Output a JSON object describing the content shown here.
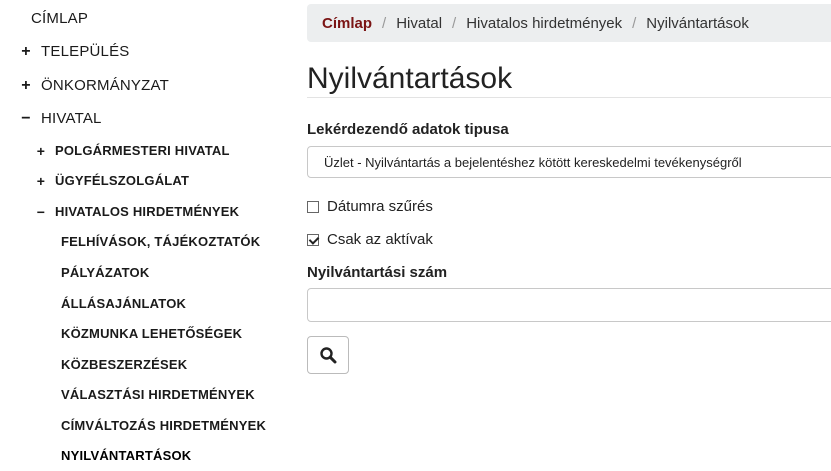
{
  "sidebar": {
    "items": [
      {
        "label": "CÍMLAP",
        "toggle": ""
      },
      {
        "label": "TELEPÜLÉS",
        "toggle": "+"
      },
      {
        "label": "ÖNKORMÁNYZAT",
        "toggle": "+"
      },
      {
        "label": "HIVATAL",
        "toggle": "−"
      },
      {
        "label": "POLGÁRMESTERI HIVATAL",
        "toggle": "+"
      },
      {
        "label": "ÜGYFÉLSZOLGÁLAT",
        "toggle": "+"
      },
      {
        "label": "HIVATALOS HIRDETMÉNYEK",
        "toggle": "−"
      },
      {
        "label": "FELHÍVÁSOK, TÁJÉKOZTATÓK"
      },
      {
        "label": "PÁLYÁZATOK"
      },
      {
        "label": "ÁLLÁSAJÁNLATOK"
      },
      {
        "label": "KÖZMUNKA LEHETŐSÉGEK"
      },
      {
        "label": "KÖZBESZERZÉSEK"
      },
      {
        "label": "VÁLASZTÁSI HIRDETMÉNYEK"
      },
      {
        "label": "CÍMVÁLTOZÁS HIRDETMÉNYEK"
      },
      {
        "label": "NYILVÁNTARTÁSOK"
      }
    ]
  },
  "breadcrumb": [
    "Címlap",
    "Hivatal",
    "Hivatalos hirdetmények",
    "Nyilvántartások"
  ],
  "page_title": "Nyilvántartások",
  "form": {
    "type_label": "Lekérdezendő adatok tipusa",
    "type_value": "Üzlet - Nyilvántartás a bejelentéshez kötött kereskedelmi tevékenységről",
    "date_filter_label": "Dátumra szűrés",
    "date_filter_checked": false,
    "active_only_label": "Csak az aktívak",
    "active_only_checked": true,
    "reg_number_label": "Nyilvántartási szám",
    "reg_number_value": ""
  },
  "icons": {
    "search_button": "search-icon"
  },
  "colors": {
    "breadcrumb_home": "#7a1414",
    "breadcrumb_bg": "#eceeef"
  }
}
